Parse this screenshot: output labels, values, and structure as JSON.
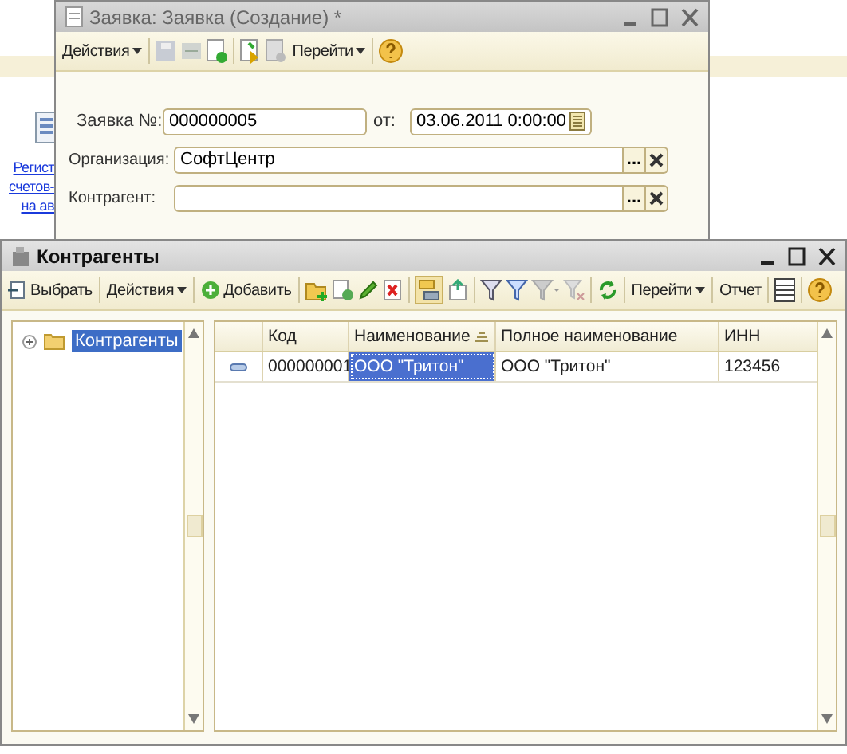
{
  "background": {
    "link_lines": [
      "Регист",
      "счетов-",
      "на ав"
    ]
  },
  "document_window": {
    "title": "Заявка: Заявка (Создание) *",
    "active": false,
    "actions_menu": "Действия",
    "goto_menu": "Перейти",
    "number": {
      "label": "Заявка №:",
      "value": "000000005"
    },
    "date": {
      "label": "от:",
      "value": "03.06.2011  0:00:00"
    },
    "fields": [
      {
        "label": "Организация:",
        "value": "СофтЦентр",
        "select_button": "..."
      },
      {
        "label": "Контрагент:",
        "select_button": "..."
      }
    ]
  },
  "list_window": {
    "title": "Контрагенты",
    "active": true,
    "toolbar": {
      "choose": "Выбрать",
      "actions": "Действия",
      "add": "Добавить",
      "goto": "Перейти",
      "report": "Отчет"
    },
    "tree": [
      {
        "label": "Контрагенты",
        "selected": true,
        "expanded": false
      }
    ],
    "table": {
      "columns": [
        {
          "title": "Код",
          "sorted": false
        },
        {
          "title": "Наименование",
          "sorted": true
        },
        {
          "title": "Полное наименование",
          "sorted": false
        },
        {
          "title": "ИНН",
          "sorted": false
        }
      ],
      "rows": [
        {
          "cells": [
            {
              "text": "000000001",
              "selected": false
            },
            {
              "text": "ООО \"Тритон\"",
              "selected": true
            },
            {
              "text": "ООО \"Тритон\"",
              "selected": false
            },
            {
              "text": "123456",
              "selected": false
            }
          ]
        }
      ]
    }
  }
}
